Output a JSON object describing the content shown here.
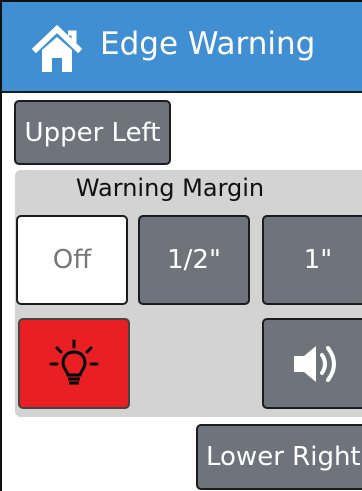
{
  "header": {
    "title": "Edge Warning",
    "icon": "home-icon",
    "color": "#3f8fd2"
  },
  "buttons": {
    "upper_left": "Upper Left",
    "lower_right": "Lower Right"
  },
  "margin_panel": {
    "title": "Warning Margin",
    "options": [
      "Off",
      "1/2\"",
      "1\""
    ],
    "selected": "Off"
  },
  "controls": {
    "light_icon": "lightbulb-icon",
    "light_color": "#ea1f23",
    "sound_icon": "speaker-icon"
  }
}
